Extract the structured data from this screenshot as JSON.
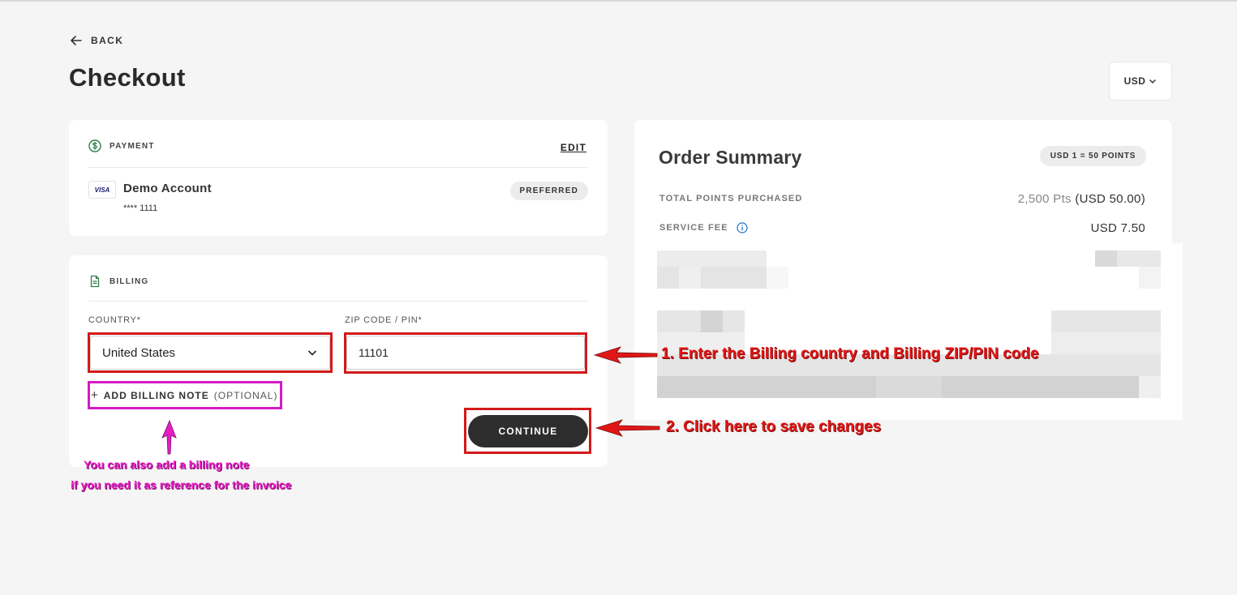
{
  "nav": {
    "back_label": "BACK"
  },
  "page": {
    "title": "Checkout"
  },
  "currency": {
    "selected": "USD"
  },
  "payment": {
    "section_label": "PAYMENT",
    "edit_label": "EDIT",
    "card_brand": "VISA",
    "account_name": "Demo Account",
    "account_number": "**** 1111",
    "badge": "PREFERRED"
  },
  "billing": {
    "section_label": "BILLING",
    "country_label": "COUNTRY*",
    "country_value": "United States",
    "zip_label": "ZIP CODE / PIN*",
    "zip_value": "11101",
    "add_note_label": "ADD BILLING NOTE",
    "add_note_optional": "(OPTIONAL)",
    "continue_label": "CONTINUE"
  },
  "summary": {
    "title": "Order Summary",
    "rate_badge": "USD 1 = 50 POINTS",
    "rows": [
      {
        "label": "TOTAL POINTS PURCHASED",
        "value_muted": "2,500 Pts",
        "value": "(USD 50.00)"
      },
      {
        "label": "SERVICE FEE",
        "value_muted": "",
        "value": "USD 7.50"
      }
    ]
  },
  "annotations": {
    "step1": "1. Enter the Billing country and Billing ZIP/PIN code",
    "step2": "2. Click here to save changes",
    "note_line1": "You can also add a billing note",
    "note_line2": "if you need it as reference for the invoice"
  },
  "colors": {
    "background": "#f5f5f5",
    "card": "#ffffff",
    "button": "#2d2d2d",
    "annotation_red": "#e01717",
    "annotation_pink": "#e81bc5",
    "info_blue": "#1a73c9"
  }
}
